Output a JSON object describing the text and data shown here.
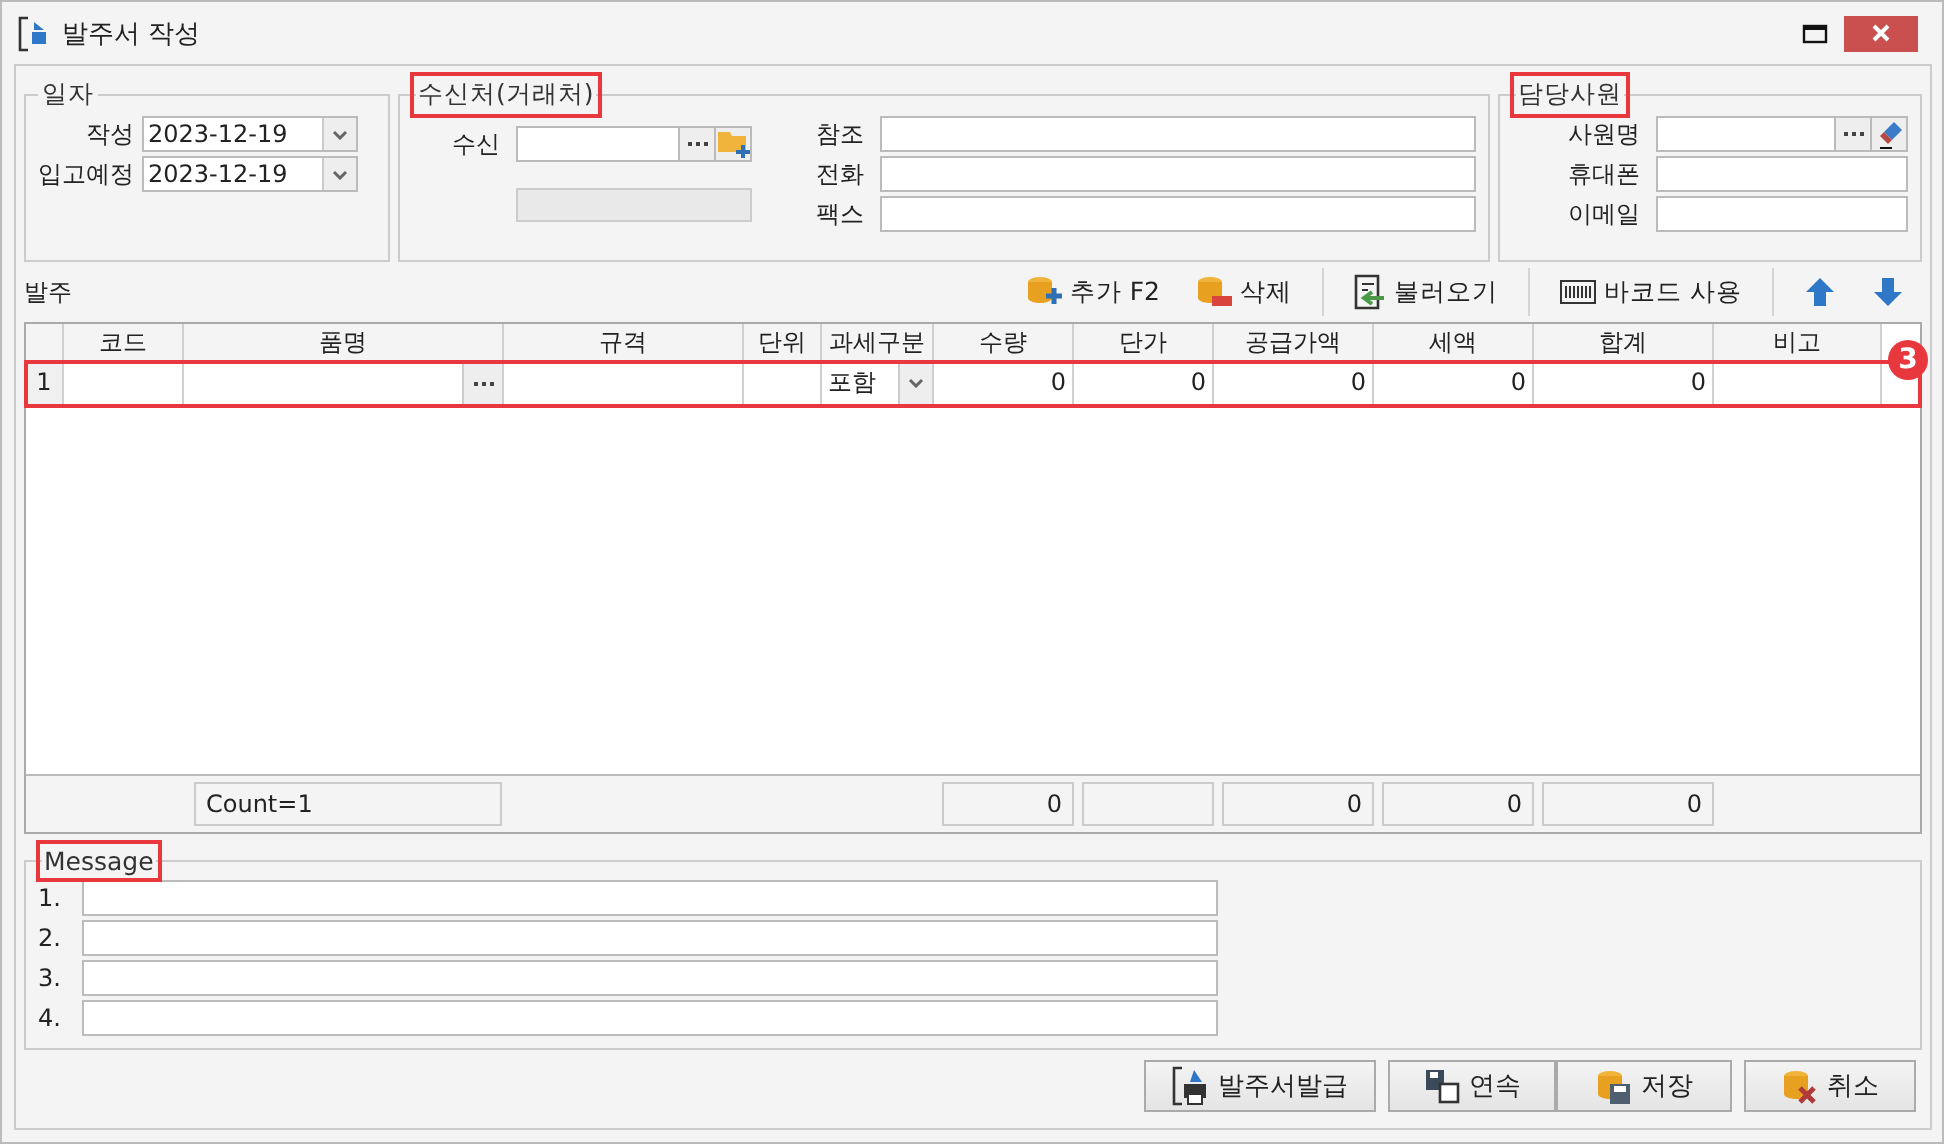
{
  "window": {
    "title": "발주서 작성"
  },
  "date_group": {
    "title": "일자",
    "highlighted": false,
    "fields": [
      {
        "label": "작성",
        "value": "2023-12-19"
      },
      {
        "label": "입고예정",
        "value": "2023-12-19"
      }
    ]
  },
  "recipient_group": {
    "title": "수신처(거래처)",
    "highlighted": true,
    "recipient_label": "수신",
    "fields": [
      {
        "label": "참조"
      },
      {
        "label": "전화"
      },
      {
        "label": "팩스"
      }
    ]
  },
  "staff_group": {
    "title": "담당사원",
    "highlighted": true,
    "fields": [
      {
        "label": "사원명",
        "kind": "lookup"
      },
      {
        "label": "휴대폰",
        "kind": "text"
      },
      {
        "label": "이메일",
        "kind": "text"
      }
    ]
  },
  "order_section": {
    "title": "발주",
    "toolbar": [
      {
        "label": "추가 F2",
        "kind": "add"
      },
      {
        "label": "삭제",
        "kind": "delete"
      },
      {
        "label": "불러오기",
        "kind": "import"
      },
      {
        "label": "바코드 사용",
        "kind": "barcode"
      },
      {
        "kind": "up"
      },
      {
        "kind": "down"
      }
    ],
    "columns": [
      "코드",
      "품명",
      "규격",
      "단위",
      "과세구분",
      "수량",
      "단가",
      "공급가액",
      "세액",
      "합계",
      "비고"
    ],
    "rows": [
      {
        "number": "1",
        "tax_type": "포함",
        "quantity": "0",
        "unit_price": "0",
        "supply_amount": "0",
        "tax": "0",
        "total": "0",
        "highlighted": true,
        "badge": "3"
      }
    ],
    "footer": {
      "count": "Count=1",
      "quantity": "0",
      "supply_amount": "0",
      "tax": "0",
      "total": "0"
    }
  },
  "message_group": {
    "title": "Message",
    "highlighted": true,
    "lines": [
      "1.",
      "2.",
      "3.",
      "4."
    ]
  },
  "buttons": [
    {
      "label": "발주서발급",
      "kind": "print"
    },
    {
      "label": "연속",
      "kind": "continue"
    },
    {
      "label": "저장",
      "kind": "save"
    },
    {
      "label": "취소",
      "kind": "cancel"
    }
  ]
}
